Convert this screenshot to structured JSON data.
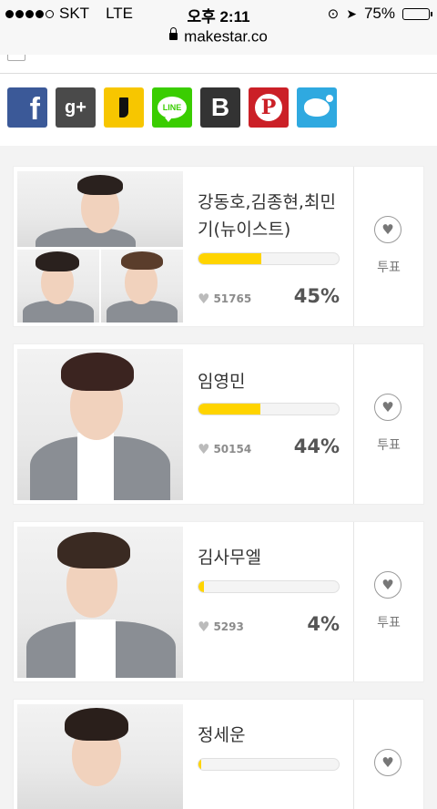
{
  "status_bar": {
    "carrier": "SKT",
    "network": "LTE",
    "time": "오후 2:11",
    "battery": "75%"
  },
  "url_bar": {
    "url": "makestar.co"
  },
  "share_buttons": [
    {
      "name": "facebook",
      "glyph": "f"
    },
    {
      "name": "google-plus",
      "glyph": "g+"
    },
    {
      "name": "kakaostory",
      "glyph": ""
    },
    {
      "name": "line",
      "glyph": "LINE"
    },
    {
      "name": "band",
      "glyph": "B"
    },
    {
      "name": "pinterest",
      "glyph": "P"
    },
    {
      "name": "twitter",
      "glyph": ""
    }
  ],
  "candidates": [
    {
      "name": "강동호,김종현,최민기(뉴이스트)",
      "votes": "51765",
      "percent": "45%",
      "percent_value": 45,
      "vote_label": "투표"
    },
    {
      "name": "임영민",
      "votes": "50154",
      "percent": "44%",
      "percent_value": 44,
      "vote_label": "투표"
    },
    {
      "name": "김사무엘",
      "votes": "5293",
      "percent": "4%",
      "percent_value": 4,
      "vote_label": "투표"
    },
    {
      "name": "정세운",
      "votes": "",
      "percent": "",
      "percent_value": 2,
      "vote_label": ""
    }
  ],
  "colors": {
    "accent_yellow": "#ffd400",
    "facebook": "#3b5998",
    "google_plus": "#4a4a4a",
    "kakaostory": "#f7c600",
    "line": "#3acd01",
    "band": "#333333",
    "pinterest": "#cb2027",
    "twitter": "#2fa9e0"
  }
}
